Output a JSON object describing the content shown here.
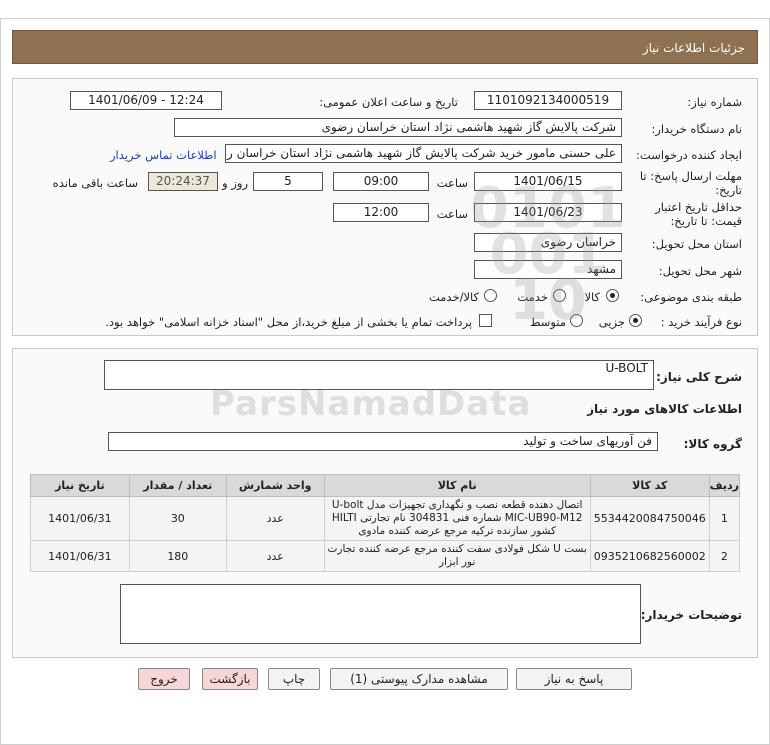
{
  "header": {
    "title": "جزئیات اطلاعات نیاز"
  },
  "form": {
    "need_number_label": "شماره نیاز:",
    "need_number": "1101092134000519",
    "announce_label": "تاریخ و ساعت اعلان عمومی:",
    "announce_value": "1401/06/09 - 12:24",
    "buyer_org_label": "نام دستگاه خریدار:",
    "buyer_org": "شرکت پالایش گاز شهید هاشمی نژاد   استان خراسان رضوی",
    "requester_label": "ایجاد کننده درخواست:",
    "requester": "علی حسنی مامور خرید شرکت پالایش گاز شهید هاشمی نژاد   استان خراسان رضوی",
    "contact_link": "اطلاعات تماس خریدار",
    "deadline_label_1": "مهلت ارسال پاسخ: تا",
    "deadline_label_2": "تاریخ:",
    "deadline_date": "1401/06/15",
    "time_label": "ساعت",
    "deadline_time": "09:00",
    "days_value": "5",
    "days_label": "روز و",
    "remaining_time": "20:24:37",
    "remaining_label": "ساعت باقی مانده",
    "validity_label_1": "حداقل تاریخ اعتبار",
    "validity_label_2": "قیمت: تا تاریخ:",
    "validity_date": "1401/06/23",
    "validity_time_label": "ساعت",
    "validity_time": "12:00",
    "province_label": "استان محل تحویل:",
    "province": "خراسان رضوی",
    "city_label": "شهر محل تحویل:",
    "city": "مشهد",
    "category_label": "طبقه بندی موضوعی:",
    "category_options": [
      "کالا",
      "خدمت",
      "کالا/خدمت"
    ],
    "process_label": "نوع فرآیند خرید :",
    "process_options": [
      "جزیی",
      "متوسط"
    ],
    "payment_note": "پرداخت تمام یا بخشی از مبلغ خرید،از محل \"اسناد خزانه اسلامی\" خواهد بود."
  },
  "summary": {
    "label": "شرح کلی نیاز:",
    "value": "U-BOLT",
    "goods_info_title": "اطلاعات کالاهای مورد نیاز",
    "group_label": "گروه کالا:",
    "group_value": "فن آوریهای ساخت و تولید"
  },
  "table": {
    "headers": [
      "ردیف",
      "کد کالا",
      "نام کالا",
      "واحد شمارش",
      "تعداد / مقدار",
      "تاریخ نیاز"
    ],
    "rows": [
      {
        "idx": "1",
        "code": "5534420084750046",
        "name": "اتصال دهنده قطعه نصب و نگهداری تجهیزات مدل U-bolt MIC-UB90-M12 شماره فنی 304831 نام تجارتی HILTI کشور سازنده ترکیه مرجع عرضه کننده مادوی",
        "unit": "عدد",
        "qty": "30",
        "date": "1401/06/31"
      },
      {
        "idx": "2",
        "code": "0935210682560002",
        "name": "بست U شکل فولادی سفت کننده مرجع عرضه کننده تجارت نور ابزار",
        "unit": "عدد",
        "qty": "180",
        "date": "1401/06/31"
      }
    ]
  },
  "notes": {
    "label": "توضیحات خریدار:",
    "value": ""
  },
  "buttons": {
    "reply": "پاسخ به نیاز",
    "attachments": "مشاهده مدارک پیوستی (1)",
    "print": "چاپ",
    "back": "بازگشت",
    "exit": "خروج"
  }
}
